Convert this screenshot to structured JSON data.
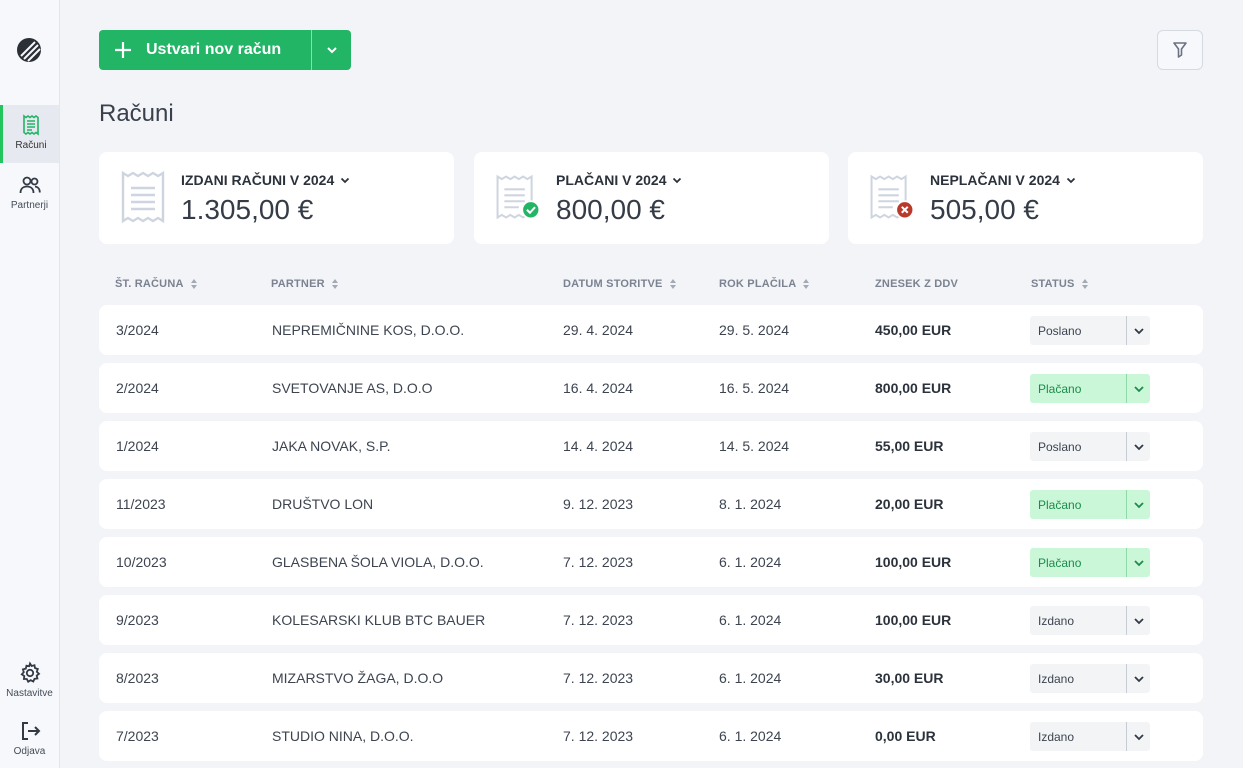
{
  "app": {
    "accent": "#22b566"
  },
  "sidebar": {
    "items": [
      {
        "label": "Računi",
        "icon": "invoice-icon",
        "active": true
      },
      {
        "label": "Partnerji",
        "icon": "users-icon",
        "active": false
      }
    ],
    "bottom": [
      {
        "label": "Nastavitve",
        "icon": "gear-icon"
      },
      {
        "label": "Odjava",
        "icon": "logout-icon"
      }
    ]
  },
  "toolbar": {
    "create_label": "Ustvari nov račun"
  },
  "page": {
    "title": "Računi"
  },
  "cards": [
    {
      "title": "IZDANI RAČUNI V 2024",
      "value": "1.305,00 €",
      "badge": "none"
    },
    {
      "title": "PLAČANI V 2024",
      "value": "800,00 €",
      "badge": "check"
    },
    {
      "title": "NEPLAČANI V 2024",
      "value": "505,00 €",
      "badge": "cross"
    }
  ],
  "table": {
    "columns": [
      "ŠT. RAČUNA",
      "PARTNER",
      "DATUM STORITVE",
      "ROK PLAČILA",
      "ZNESEK Z DDV",
      "STATUS"
    ],
    "rows": [
      {
        "number": "3/2024",
        "partner": "NEPREMIČNINE KOS, D.O.O.",
        "service_date": "29. 4. 2024",
        "due_date": "29. 5. 2024",
        "amount": "450,00 EUR",
        "status": "Poslano"
      },
      {
        "number": "2/2024",
        "partner": "SVETOVANJE AS, D.O.O",
        "service_date": "16. 4. 2024",
        "due_date": "16. 5. 2024",
        "amount": "800,00 EUR",
        "status": "Plačano"
      },
      {
        "number": "1/2024",
        "partner": "JAKA NOVAK, S.P.",
        "service_date": "14. 4. 2024",
        "due_date": "14. 5. 2024",
        "amount": "55,00 EUR",
        "status": "Poslano"
      },
      {
        "number": "11/2023",
        "partner": "DRUŠTVO LON",
        "service_date": "9. 12. 2023",
        "due_date": "8. 1. 2024",
        "amount": "20,00 EUR",
        "status": "Plačano"
      },
      {
        "number": "10/2023",
        "partner": "GLASBENA ŠOLA VIOLA, D.O.O.",
        "service_date": "7. 12. 2023",
        "due_date": "6. 1. 2024",
        "amount": "100,00 EUR",
        "status": "Plačano"
      },
      {
        "number": "9/2023",
        "partner": "KOLESARSKI KLUB BTC BAUER",
        "service_date": "7. 12. 2023",
        "due_date": "6. 1. 2024",
        "amount": "100,00 EUR",
        "status": "Izdano"
      },
      {
        "number": "8/2023",
        "partner": "MIZARSTVO ŽAGA, D.O.O",
        "service_date": "7. 12. 2023",
        "due_date": "6. 1. 2024",
        "amount": "30,00 EUR",
        "status": "Izdano"
      },
      {
        "number": "7/2023",
        "partner": "STUDIO NINA, D.O.O.",
        "service_date": "7. 12. 2023",
        "due_date": "6. 1. 2024",
        "amount": "0,00 EUR",
        "status": "Izdano"
      }
    ]
  }
}
